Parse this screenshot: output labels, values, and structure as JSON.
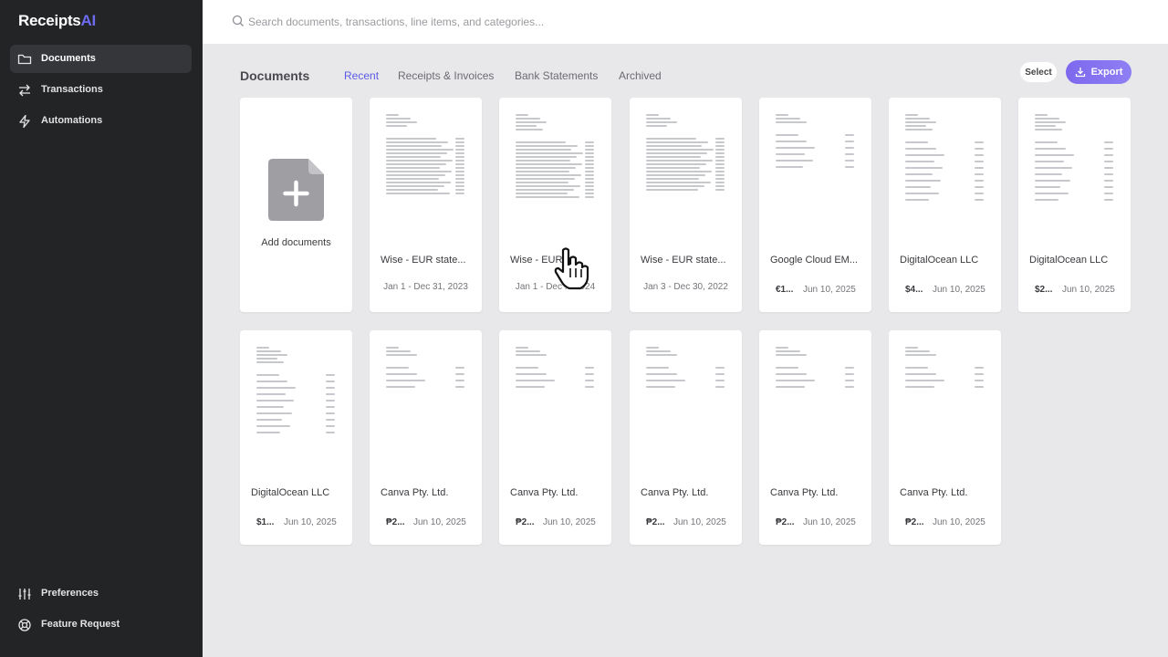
{
  "app": {
    "logo_main": "Receipts",
    "logo_accent": "AI",
    "brand_color": "#6d6cf0"
  },
  "sidebar": {
    "items": [
      {
        "label": "Documents",
        "icon": "folder-icon",
        "active": true
      },
      {
        "label": "Transactions",
        "icon": "arrows-exchange-icon"
      },
      {
        "label": "Automations",
        "icon": "lightning-icon"
      }
    ],
    "bottom_items": [
      {
        "label": "Preferences",
        "icon": "sliders-icon"
      },
      {
        "label": "Feature Request",
        "icon": "lifebuoy-icon"
      }
    ]
  },
  "search": {
    "placeholder": "Search documents, transactions, line items, and categories..."
  },
  "documents": {
    "title": "Documents",
    "tabs": [
      {
        "label": "Recent",
        "active": true
      },
      {
        "label": "Receipts & Invoices"
      },
      {
        "label": "Bank Statements"
      },
      {
        "label": "Archived"
      }
    ],
    "select_label": "Select",
    "export_label": "Export",
    "add_label": "Add documents",
    "cards": [
      {
        "title": "Wise - EUR state...",
        "range": "Jan 1 - Dec 31, 2023"
      },
      {
        "title": "Wise - EUR ...",
        "range": "Jan 1 - Dec ... 2024"
      },
      {
        "title": "Wise - EUR state...",
        "range": "Jan 3 - Dec 30, 2022"
      },
      {
        "title": "Google Cloud EM...",
        "amount": "€1...",
        "date": "Jun 10, 2025"
      },
      {
        "title": "DigitalOcean LLC",
        "amount": "$4...",
        "date": "Jun 10, 2025"
      },
      {
        "title": "DigitalOcean LLC",
        "amount": "$2...",
        "date": "Jun 10, 2025"
      },
      {
        "title": "DigitalOcean LLC",
        "amount": "$1...",
        "date": "Jun 10, 2025"
      },
      {
        "title": "Canva Pty. Ltd.",
        "amount": "₱2...",
        "date": "Jun 10, 2025"
      },
      {
        "title": "Canva Pty. Ltd.",
        "amount": "₱2...",
        "date": "Jun 10, 2025"
      },
      {
        "title": "Canva Pty. Ltd.",
        "amount": "₱2...",
        "date": "Jun 10, 2025"
      },
      {
        "title": "Canva Pty. Ltd.",
        "amount": "₱2...",
        "date": "Jun 10, 2025"
      },
      {
        "title": "Canva Pty. Ltd.",
        "amount": "₱2...",
        "date": "Jun 10, 2025"
      }
    ]
  }
}
